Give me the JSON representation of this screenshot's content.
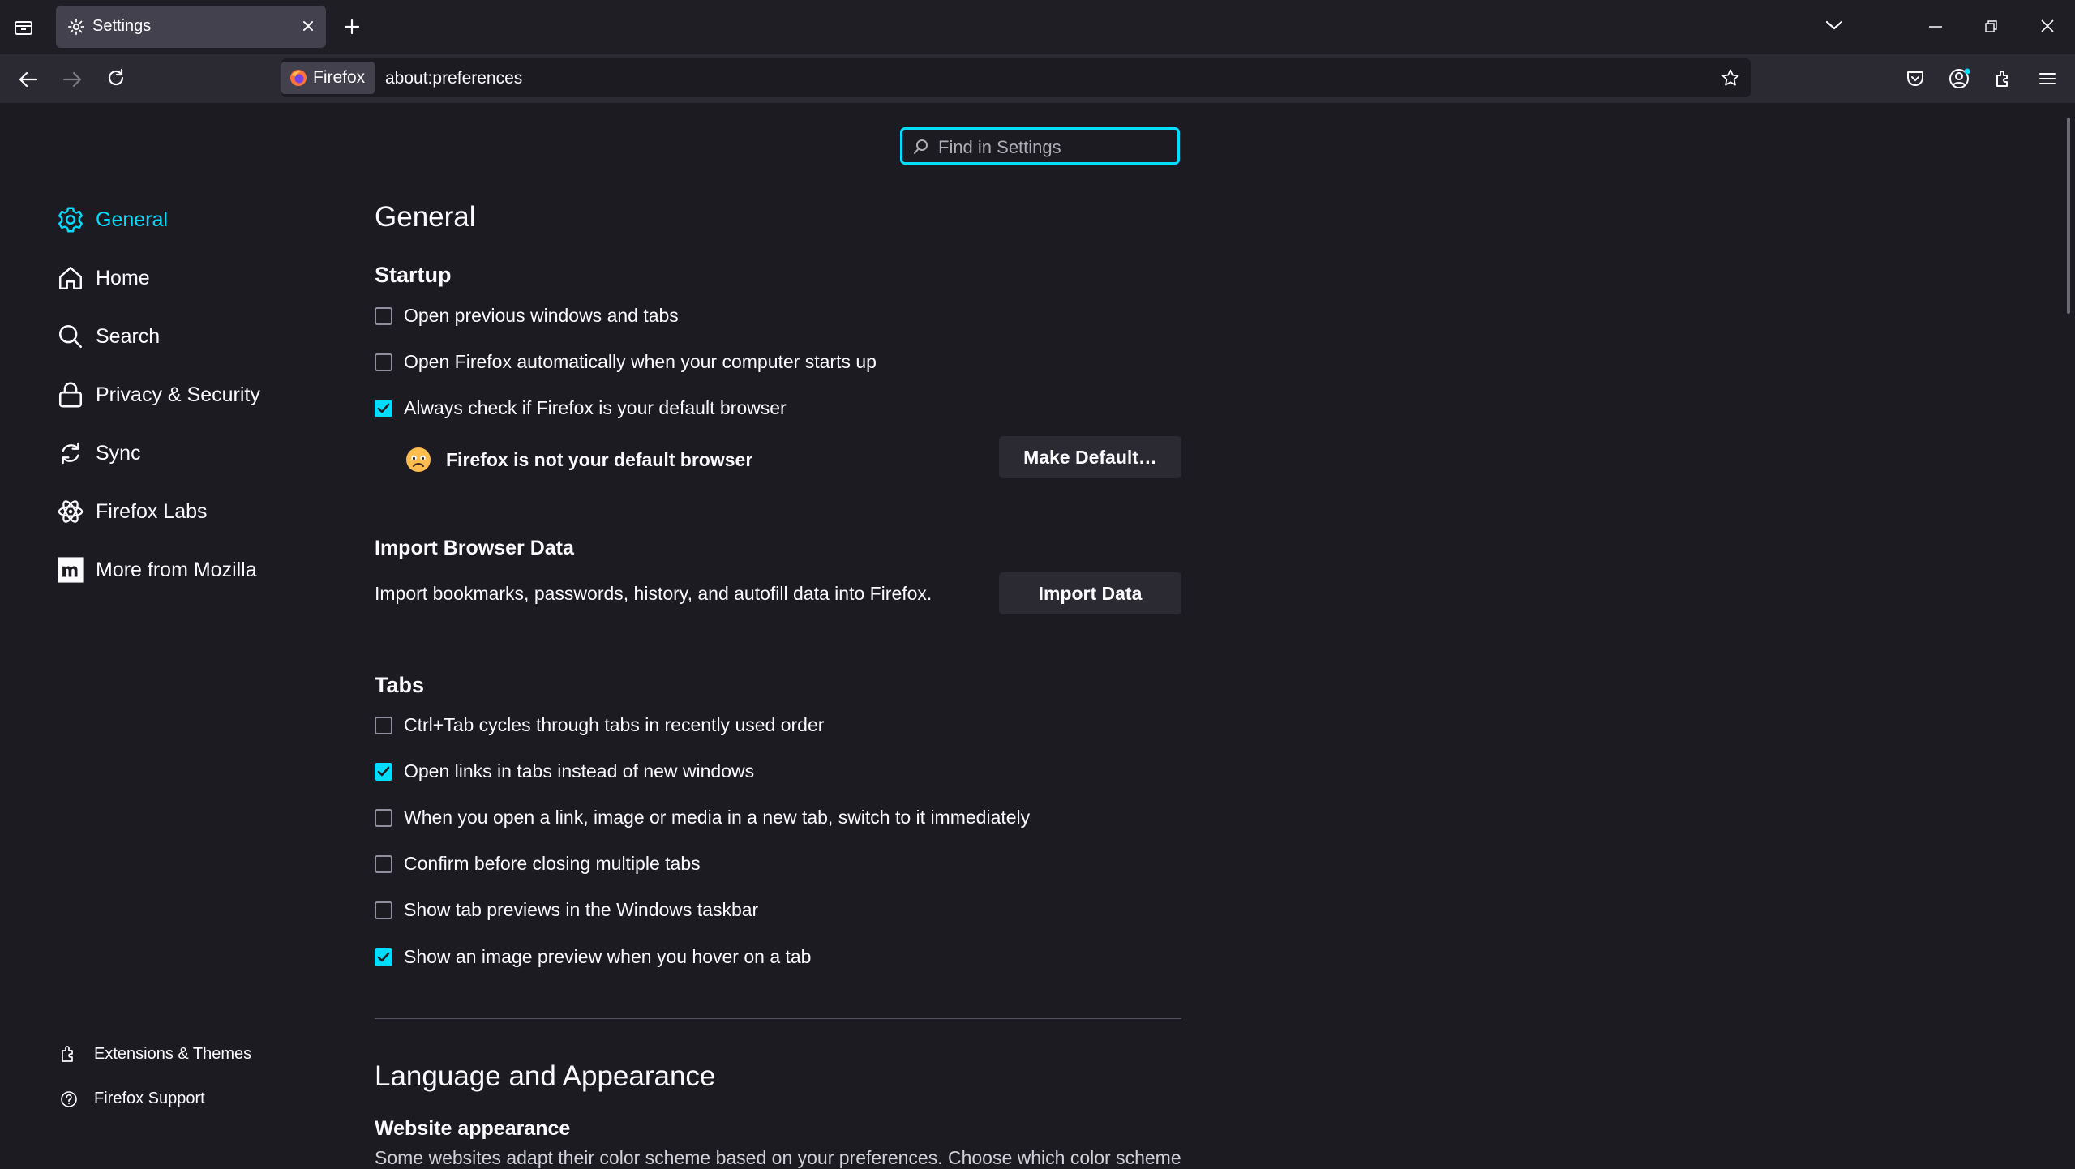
{
  "tab": {
    "title": "Settings"
  },
  "urlbar": {
    "identity_label": "Firefox",
    "url": "about:preferences"
  },
  "search": {
    "placeholder": "Find in Settings"
  },
  "categories": [
    {
      "label": "General",
      "icon": "gear-icon",
      "selected": true
    },
    {
      "label": "Home",
      "icon": "home-icon"
    },
    {
      "label": "Search",
      "icon": "search-icon"
    },
    {
      "label": "Privacy & Security",
      "icon": "lock-icon"
    },
    {
      "label": "Sync",
      "icon": "sync-icon"
    },
    {
      "label": "Firefox Labs",
      "icon": "flask-icon"
    },
    {
      "label": "More from Mozilla",
      "icon": "mozilla-m-icon"
    }
  ],
  "footer_links": [
    {
      "label": "Extensions & Themes",
      "icon": "puzzle-icon"
    },
    {
      "label": "Firefox Support",
      "icon": "help-icon"
    }
  ],
  "main": {
    "title": "General",
    "startup": {
      "heading": "Startup",
      "options": [
        {
          "label": "Open previous windows and tabs",
          "checked": false
        },
        {
          "label": "Open Firefox automatically when your computer starts up",
          "checked": false
        },
        {
          "label": "Always check if Firefox is your default browser",
          "checked": true
        }
      ],
      "default_status": "Firefox is not your default browser",
      "make_default_button": "Make Default…"
    },
    "import": {
      "heading": "Import Browser Data",
      "description": "Import bookmarks, passwords, history, and autofill data into Firefox.",
      "button": "Import Data"
    },
    "tabs": {
      "heading": "Tabs",
      "options": [
        {
          "label": "Ctrl+Tab cycles through tabs in recently used order",
          "checked": false
        },
        {
          "label": "Open links in tabs instead of new windows",
          "checked": true
        },
        {
          "label": "When you open a link, image or media in a new tab, switch to it immediately",
          "checked": false
        },
        {
          "label": "Confirm before closing multiple tabs",
          "checked": false
        },
        {
          "label": "Show tab previews in the Windows taskbar",
          "checked": false
        },
        {
          "label": "Show an image preview when you hover on a tab",
          "checked": true
        }
      ]
    },
    "language": {
      "heading": "Language and Appearance",
      "website_appearance": {
        "heading": "Website appearance",
        "description": "Some websites adapt their color scheme based on your preferences. Choose which color scheme"
      }
    }
  },
  "colors": {
    "accent": "#00ddff",
    "background": "#1c1b22"
  }
}
